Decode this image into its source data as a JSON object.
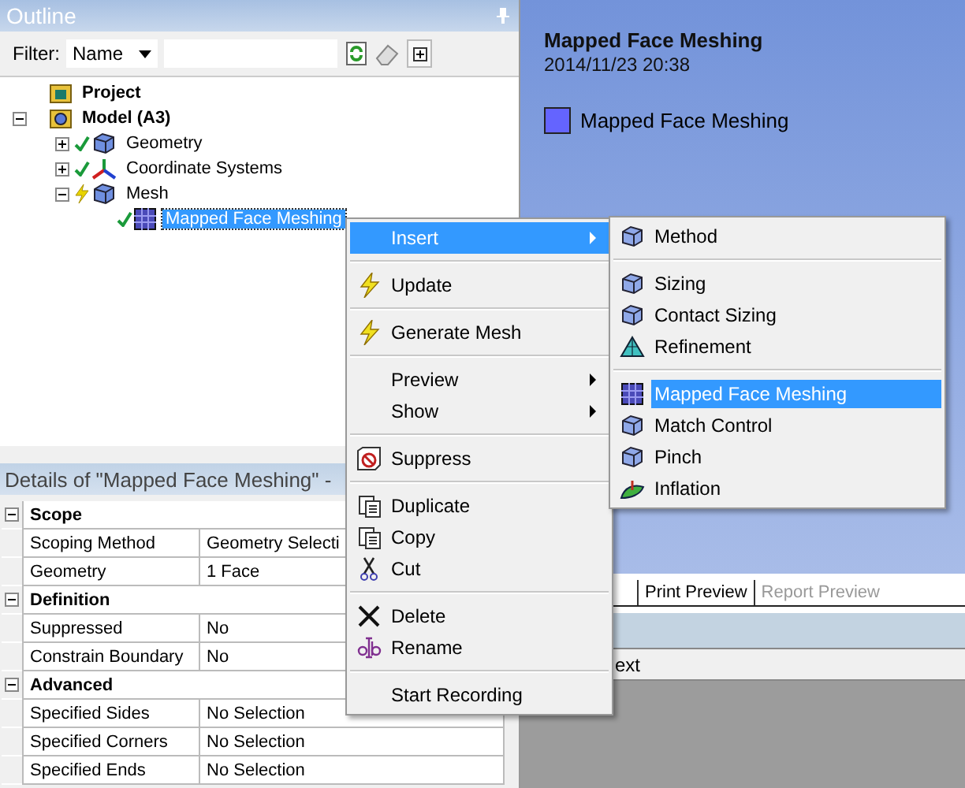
{
  "outline": {
    "title": "Outline",
    "filter_label": "Filter:",
    "filter_value": "Name"
  },
  "tree": [
    {
      "label": "Project",
      "selected": false,
      "children": [
        {
          "label": "Model (A3)",
          "expanded": true,
          "selected": false,
          "children": [
            {
              "label": "Geometry",
              "expanded": false,
              "selected": false,
              "done": true
            },
            {
              "label": "Coordinate Systems",
              "expanded": false,
              "selected": false,
              "done": true
            },
            {
              "label": "Mesh",
              "expanded": true,
              "selected": false,
              "done": false,
              "children": [
                {
                  "label": "Mapped Face Meshing",
                  "selected": true,
                  "done": true
                }
              ]
            }
          ]
        }
      ]
    }
  ],
  "details": {
    "title": "Details of \"Mapped Face Meshing\" -",
    "sections": [
      {
        "title": "Scope",
        "expanded": true,
        "rows": [
          {
            "name": "Scoping Method",
            "value": "Geometry Selecti"
          },
          {
            "name": "Geometry",
            "value": "1 Face"
          }
        ]
      },
      {
        "title": "Definition",
        "expanded": true,
        "rows": [
          {
            "name": "Suppressed",
            "value": "No"
          },
          {
            "name": "Constrain Boundary",
            "value": "No"
          }
        ]
      },
      {
        "title": "Advanced",
        "expanded": true,
        "rows": [
          {
            "name": "Specified Sides",
            "value": "No Selection"
          },
          {
            "name": "Specified Corners",
            "value": "No Selection"
          },
          {
            "name": "Specified Ends",
            "value": "No Selection"
          }
        ]
      }
    ]
  },
  "viewer": {
    "title": "Mapped Face Meshing",
    "date": "2014/11/23 20:38",
    "legend": [
      {
        "label": "Mapped Face Meshing",
        "color": "#6464ff"
      }
    ]
  },
  "tabs": [
    {
      "label": "Print Preview",
      "disabled": false
    },
    {
      "label": "Report Preview",
      "disabled": true
    }
  ],
  "bottom_text": "ext",
  "context_menu": [
    {
      "kind": "item",
      "label": "Insert",
      "selected": true,
      "submenu": true
    },
    {
      "kind": "separator"
    },
    {
      "kind": "item",
      "label": "Update",
      "selected": false,
      "submenu": false
    },
    {
      "kind": "separator"
    },
    {
      "kind": "item",
      "label": "Generate Mesh",
      "selected": false,
      "submenu": false
    },
    {
      "kind": "separator"
    },
    {
      "kind": "item",
      "label": "Preview",
      "selected": false,
      "submenu": true
    },
    {
      "kind": "item",
      "label": "Show",
      "selected": false,
      "submenu": true
    },
    {
      "kind": "separator"
    },
    {
      "kind": "item",
      "label": "Suppress",
      "selected": false,
      "submenu": false
    },
    {
      "kind": "separator"
    },
    {
      "kind": "item",
      "label": "Duplicate",
      "selected": false,
      "submenu": false
    },
    {
      "kind": "item",
      "label": "Copy",
      "selected": false,
      "submenu": false
    },
    {
      "kind": "item",
      "label": "Cut",
      "selected": false,
      "submenu": false
    },
    {
      "kind": "separator"
    },
    {
      "kind": "item",
      "label": "Delete",
      "selected": false,
      "submenu": false
    },
    {
      "kind": "item",
      "label": "Rename",
      "selected": false,
      "submenu": false
    },
    {
      "kind": "separator"
    },
    {
      "kind": "item",
      "label": "Start Recording",
      "selected": false,
      "submenu": false
    }
  ],
  "insert_menu": [
    {
      "kind": "item",
      "label": "Method",
      "selected": false
    },
    {
      "kind": "separator"
    },
    {
      "kind": "item",
      "label": "Sizing",
      "selected": false
    },
    {
      "kind": "item",
      "label": "Contact Sizing",
      "selected": false
    },
    {
      "kind": "item",
      "label": "Refinement",
      "selected": false
    },
    {
      "kind": "separator"
    },
    {
      "kind": "item",
      "label": "Mapped Face Meshing",
      "selected": true
    },
    {
      "kind": "item",
      "label": "Match Control",
      "selected": false
    },
    {
      "kind": "item",
      "label": "Pinch",
      "selected": false
    },
    {
      "kind": "item",
      "label": "Inflation",
      "selected": false
    }
  ]
}
